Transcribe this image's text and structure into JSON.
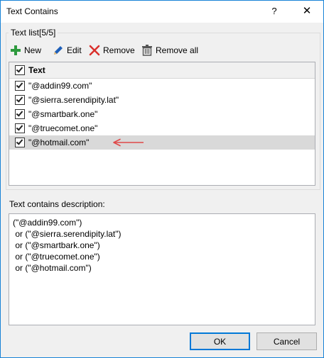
{
  "window": {
    "title": "Text Contains",
    "help_glyph": "?",
    "close_glyph": "✕"
  },
  "group": {
    "label": "Text list[5/5]"
  },
  "toolbar": {
    "new_label": "New",
    "edit_label": "Edit",
    "remove_label": "Remove",
    "remove_all_label": "Remove all",
    "icons": [
      "plus-icon",
      "pencil-icon",
      "red-x-icon",
      "trash-can-icon"
    ],
    "colors": {
      "new": "#2e9a3e",
      "edit": "#1e5fb8",
      "remove": "#d9302c"
    }
  },
  "list": {
    "header": "Text",
    "items": [
      {
        "text": "\"@addin99.com\"",
        "checked": true
      },
      {
        "text": "\"@sierra.serendipity.lat\"",
        "checked": true
      },
      {
        "text": "\"@smartbark.one\"",
        "checked": true
      },
      {
        "text": "\"@truecomet.one\"",
        "checked": true
      },
      {
        "text": "\"@hotmail.com\"",
        "checked": true,
        "selected": true
      }
    ],
    "arrow_color": "#e04848"
  },
  "description": {
    "label": "Text contains description:",
    "lines": [
      "(\"@addin99.com\")",
      " or (\"@sierra.serendipity.lat\")",
      " or (\"@smartbark.one\")",
      " or (\"@truecomet.one\")",
      " or (\"@hotmail.com\")"
    ]
  },
  "buttons": {
    "ok": "OK",
    "cancel": "Cancel"
  },
  "colors": {
    "window_border": "#1883d7",
    "default_button_border": "#0078d7",
    "selected_row": "#d9d9d9"
  }
}
